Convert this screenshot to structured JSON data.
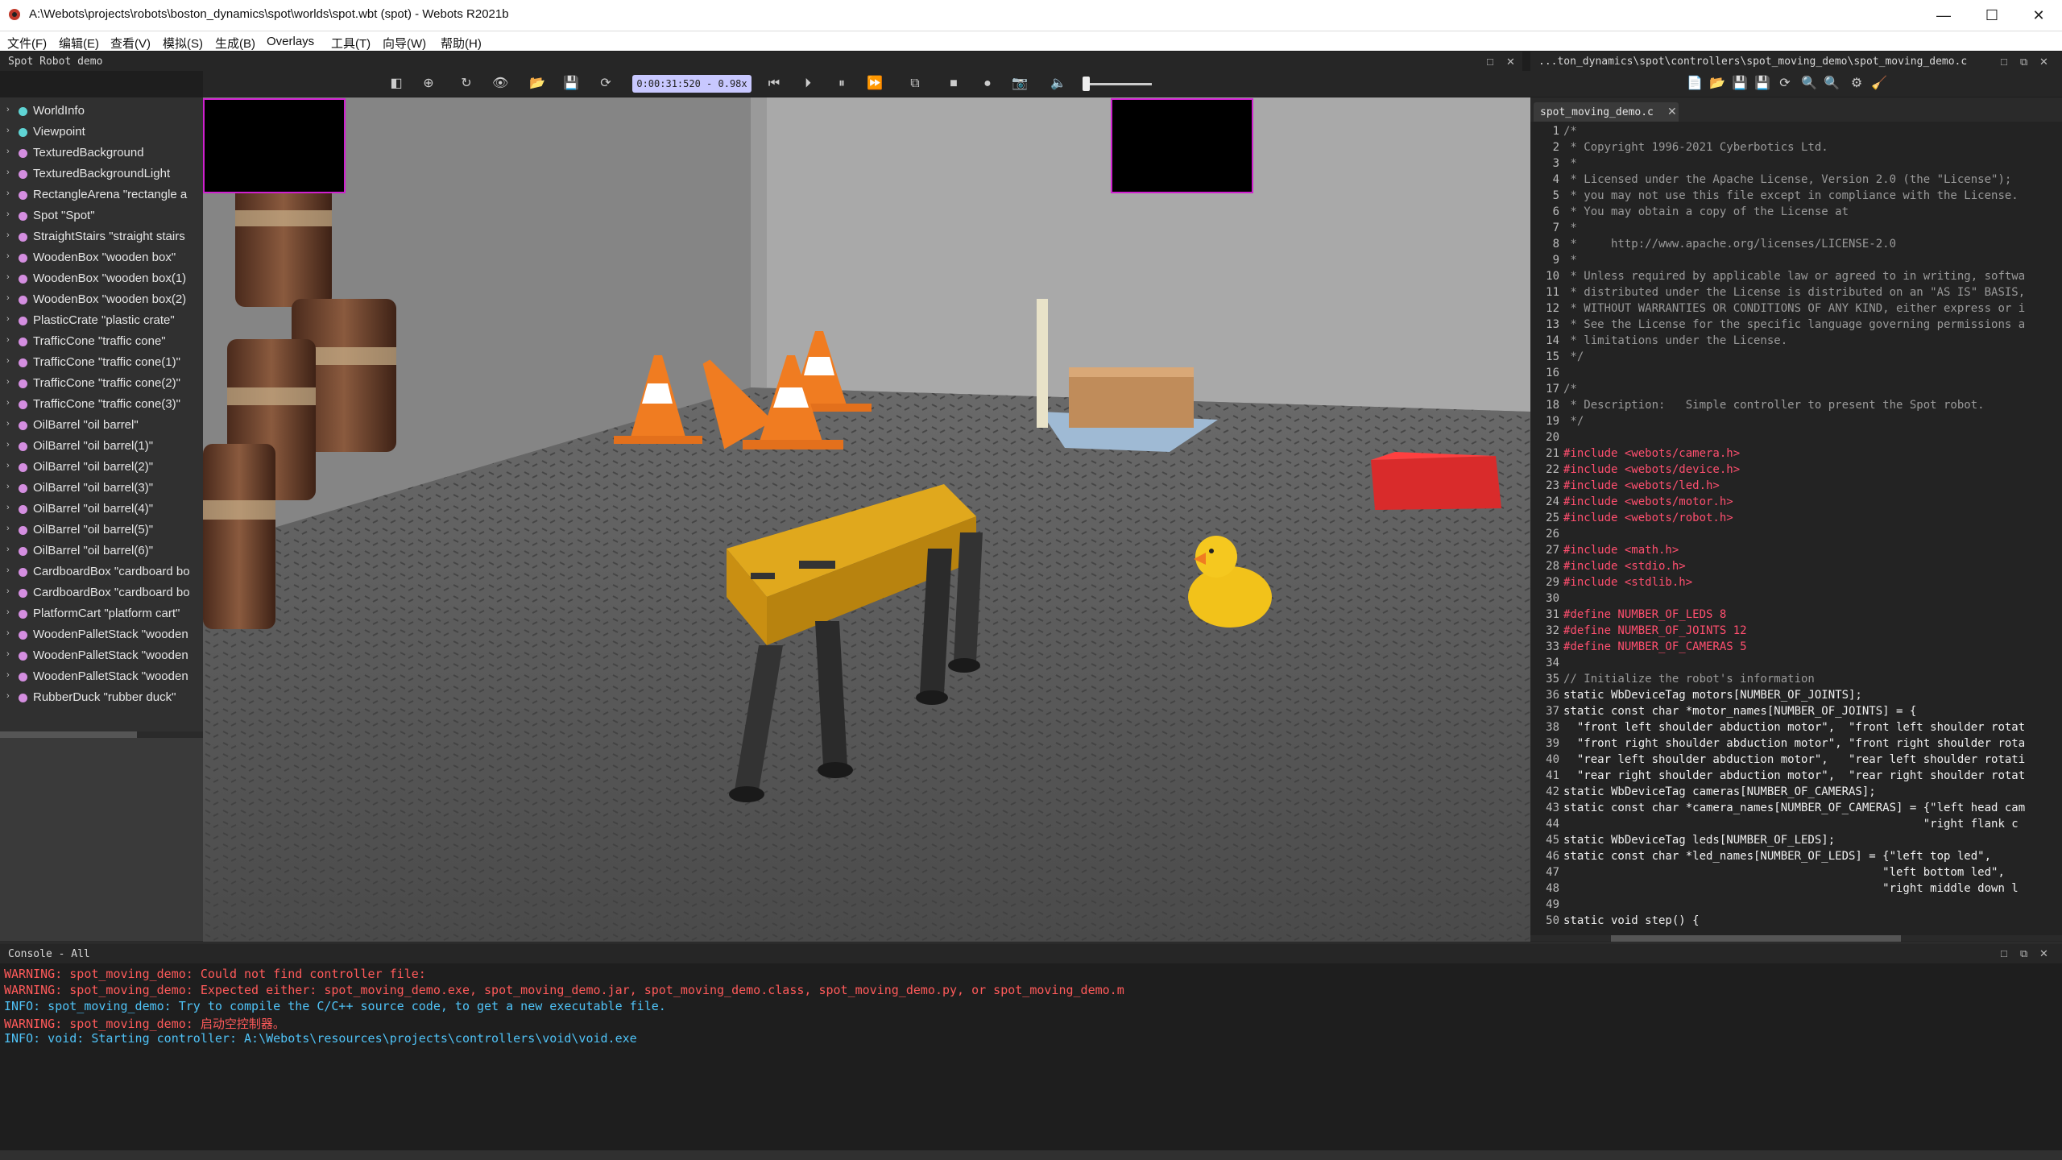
{
  "window": {
    "title": "A:\\Webots\\projects\\robots\\boston_dynamics\\spot\\worlds\\spot.wbt (spot) - Webots R2021b",
    "controls": {
      "minimize": "—",
      "maximize": "☐",
      "close": "✕"
    }
  },
  "menubar": {
    "items": [
      "文件(F)",
      "编辑(E)",
      "查看(V)",
      "模拟(S)",
      "生成(B)",
      "Overlays",
      "工具(T)",
      "向导(W)",
      "帮助(H)"
    ]
  },
  "scene_tree": {
    "title": "Spot Robot demo",
    "nodes": [
      {
        "label": "WorldInfo",
        "dot_color": "#5fd4d4"
      },
      {
        "label": "Viewpoint",
        "dot_color": "#5fd4d4"
      },
      {
        "label": "TexturedBackground",
        "dot_color": "#d48ee0"
      },
      {
        "label": "TexturedBackgroundLight",
        "dot_color": "#d48ee0"
      },
      {
        "label": "RectangleArena \"rectangle a",
        "dot_color": "#d48ee0"
      },
      {
        "label": "Spot \"Spot\"",
        "dot_color": "#d48ee0"
      },
      {
        "label": "StraightStairs \"straight stairs",
        "dot_color": "#d48ee0"
      },
      {
        "label": "WoodenBox \"wooden box\"",
        "dot_color": "#d48ee0"
      },
      {
        "label": "WoodenBox \"wooden box(1)",
        "dot_color": "#d48ee0"
      },
      {
        "label": "WoodenBox \"wooden box(2)",
        "dot_color": "#d48ee0"
      },
      {
        "label": "PlasticCrate \"plastic crate\"",
        "dot_color": "#d48ee0"
      },
      {
        "label": "TrafficCone \"traffic cone\"",
        "dot_color": "#d48ee0"
      },
      {
        "label": "TrafficCone \"traffic cone(1)\"",
        "dot_color": "#d48ee0"
      },
      {
        "label": "TrafficCone \"traffic cone(2)\"",
        "dot_color": "#d48ee0"
      },
      {
        "label": "TrafficCone \"traffic cone(3)\"",
        "dot_color": "#d48ee0"
      },
      {
        "label": "OilBarrel \"oil barrel\"",
        "dot_color": "#d48ee0"
      },
      {
        "label": "OilBarrel \"oil barrel(1)\"",
        "dot_color": "#d48ee0"
      },
      {
        "label": "OilBarrel \"oil barrel(2)\"",
        "dot_color": "#d48ee0"
      },
      {
        "label": "OilBarrel \"oil barrel(3)\"",
        "dot_color": "#d48ee0"
      },
      {
        "label": "OilBarrel \"oil barrel(4)\"",
        "dot_color": "#d48ee0"
      },
      {
        "label": "OilBarrel \"oil barrel(5)\"",
        "dot_color": "#d48ee0"
      },
      {
        "label": "OilBarrel \"oil barrel(6)\"",
        "dot_color": "#d48ee0"
      },
      {
        "label": "CardboardBox \"cardboard bo",
        "dot_color": "#d48ee0"
      },
      {
        "label": "CardboardBox \"cardboard bo",
        "dot_color": "#d48ee0"
      },
      {
        "label": "PlatformCart \"platform cart\"",
        "dot_color": "#d48ee0"
      },
      {
        "label": "WoodenPalletStack \"wooden",
        "dot_color": "#d48ee0"
      },
      {
        "label": "WoodenPalletStack \"wooden",
        "dot_color": "#d48ee0"
      },
      {
        "label": "WoodenPalletStack \"wooden",
        "dot_color": "#d48ee0"
      },
      {
        "label": "RubberDuck \"rubber duck\"",
        "dot_color": "#d48ee0"
      }
    ]
  },
  "toolbar3d": {
    "sim_time": "0:00:31:520 - 0.98x",
    "icons": [
      "toggle-scene-tree-icon",
      "add-node-icon",
      "reset-view-icon",
      "view-menu-icon",
      "open-world-icon",
      "save-world-icon",
      "reload-world-icon",
      "step-back-icon",
      "step-icon",
      "pause-icon",
      "fast-forward-icon",
      "fullscreen-icon",
      "stop-record-icon",
      "record-icon",
      "screenshot-icon",
      "volume-icon"
    ],
    "volume_level": 0.0
  },
  "editor": {
    "path": "...ton_dynamics\\spot\\controllers\\spot_moving_demo\\spot_moving_demo.c",
    "tab": "spot_moving_demo.c",
    "lines": [
      {
        "n": "1",
        "text": "/*",
        "color": "#9a9a9a"
      },
      {
        "n": "2",
        "text": " * Copyright 1996-2021 Cyberbotics Ltd.",
        "color": "#9a9a9a"
      },
      {
        "n": "3",
        "text": " *",
        "color": "#9a9a9a"
      },
      {
        "n": "4",
        "text": " * Licensed under the Apache License, Version 2.0 (the \"License\");",
        "color": "#9a9a9a"
      },
      {
        "n": "5",
        "text": " * you may not use this file except in compliance with the License.",
        "color": "#9a9a9a"
      },
      {
        "n": "6",
        "text": " * You may obtain a copy of the License at",
        "color": "#9a9a9a"
      },
      {
        "n": "7",
        "text": " *",
        "color": "#9a9a9a"
      },
      {
        "n": "8",
        "text": " *     http://www.apache.org/licenses/LICENSE-2.0",
        "color": "#9a9a9a"
      },
      {
        "n": "9",
        "text": " *",
        "color": "#9a9a9a"
      },
      {
        "n": "10",
        "text": " * Unless required by applicable law or agreed to in writing, softwa",
        "color": "#9a9a9a"
      },
      {
        "n": "11",
        "text": " * distributed under the License is distributed on an \"AS IS\" BASIS,",
        "color": "#9a9a9a"
      },
      {
        "n": "12",
        "text": " * WITHOUT WARRANTIES OR CONDITIONS OF ANY KIND, either express or i",
        "color": "#9a9a9a"
      },
      {
        "n": "13",
        "text": " * See the License for the specific language governing permissions a",
        "color": "#9a9a9a"
      },
      {
        "n": "14",
        "text": " * limitations under the License.",
        "color": "#9a9a9a"
      },
      {
        "n": "15",
        "text": " */",
        "color": "#9a9a9a"
      },
      {
        "n": "16",
        "text": "",
        "color": "#9a9a9a"
      },
      {
        "n": "17",
        "text": "/*",
        "color": "#9a9a9a"
      },
      {
        "n": "18",
        "text": " * Description:   Simple controller to present the Spot robot.",
        "color": "#9a9a9a"
      },
      {
        "n": "19",
        "text": " */",
        "color": "#9a9a9a"
      },
      {
        "n": "20",
        "text": "",
        "color": "#9a9a9a"
      },
      {
        "n": "21",
        "text": "#include <webots/camera.h>",
        "color": "#ff4f6f"
      },
      {
        "n": "22",
        "text": "#include <webots/device.h>",
        "color": "#ff4f6f"
      },
      {
        "n": "23",
        "text": "#include <webots/led.h>",
        "color": "#ff4f6f"
      },
      {
        "n": "24",
        "text": "#include <webots/motor.h>",
        "color": "#ff4f6f"
      },
      {
        "n": "25",
        "text": "#include <webots/robot.h>",
        "color": "#ff4f6f"
      },
      {
        "n": "26",
        "text": "",
        "color": "#9a9a9a"
      },
      {
        "n": "27",
        "text": "#include <math.h>",
        "color": "#ff4f6f"
      },
      {
        "n": "28",
        "text": "#include <stdio.h>",
        "color": "#ff4f6f"
      },
      {
        "n": "29",
        "text": "#include <stdlib.h>",
        "color": "#ff4f6f"
      },
      {
        "n": "30",
        "text": "",
        "color": "#9a9a9a"
      },
      {
        "n": "31",
        "text": "#define NUMBER_OF_LEDS 8",
        "color": "#ff4f6f"
      },
      {
        "n": "32",
        "text": "#define NUMBER_OF_JOINTS 12",
        "color": "#ff4f6f"
      },
      {
        "n": "33",
        "text": "#define NUMBER_OF_CAMERAS 5",
        "color": "#ff4f6f"
      },
      {
        "n": "34",
        "text": "",
        "color": "#9a9a9a"
      },
      {
        "n": "35",
        "text": "// Initialize the robot's information",
        "color": "#9a9a9a"
      },
      {
        "n": "36",
        "text": "static WbDeviceTag motors[NUMBER_OF_JOINTS];",
        "color": "#f0f0f0"
      },
      {
        "n": "37",
        "text": "static const char *motor_names[NUMBER_OF_JOINTS] = {",
        "color": "#f0f0f0"
      },
      {
        "n": "38",
        "text": "  \"front left shoulder abduction motor\",  \"front left shoulder rotat",
        "color": "#f0f0f0"
      },
      {
        "n": "39",
        "text": "  \"front right shoulder abduction motor\", \"front right shoulder rota",
        "color": "#f0f0f0"
      },
      {
        "n": "40",
        "text": "  \"rear left shoulder abduction motor\",   \"rear left shoulder rotati",
        "color": "#f0f0f0"
      },
      {
        "n": "41",
        "text": "  \"rear right shoulder abduction motor\",  \"rear right shoulder rotat",
        "color": "#f0f0f0"
      },
      {
        "n": "42",
        "text": "static WbDeviceTag cameras[NUMBER_OF_CAMERAS];",
        "color": "#f0f0f0"
      },
      {
        "n": "43",
        "text": "static const char *camera_names[NUMBER_OF_CAMERAS] = {\"left head cam",
        "color": "#f0f0f0"
      },
      {
        "n": "44",
        "text": "                                                     \"right flank c",
        "color": "#f0f0f0"
      },
      {
        "n": "45",
        "text": "static WbDeviceTag leds[NUMBER_OF_LEDS];",
        "color": "#f0f0f0"
      },
      {
        "n": "46",
        "text": "static const char *led_names[NUMBER_OF_LEDS] = {\"left top led\",",
        "color": "#f0f0f0"
      },
      {
        "n": "47",
        "text": "                                               \"left bottom led\",",
        "color": "#f0f0f0"
      },
      {
        "n": "48",
        "text": "                                               \"right middle down l",
        "color": "#f0f0f0"
      },
      {
        "n": "49",
        "text": "",
        "color": "#9a9a9a"
      },
      {
        "n": "50",
        "text": "static void step() {",
        "color": "#f0f0f0"
      }
    ]
  },
  "console": {
    "title": "Console - All",
    "lines": [
      {
        "text": "WARNING: spot_moving_demo: Could not find controller file:",
        "color": "#ff5a5a"
      },
      {
        "text": "WARNING: spot_moving_demo: Expected either: spot_moving_demo.exe, spot_moving_demo.jar, spot_moving_demo.class, spot_moving_demo.py, or spot_moving_demo.m",
        "color": "#ff5a5a"
      },
      {
        "text": "INFO: spot_moving_demo: Try to compile the C/C++ source code, to get a new executable file.",
        "color": "#4fc3f7"
      },
      {
        "text": "WARNING: spot_moving_demo: 启动空控制器。",
        "color": "#ff5a5a"
      },
      {
        "text": "INFO: void: Starting controller: A:\\Webots\\resources\\projects\\controllers\\void\\void.exe",
        "color": "#4fc3f7"
      }
    ]
  }
}
